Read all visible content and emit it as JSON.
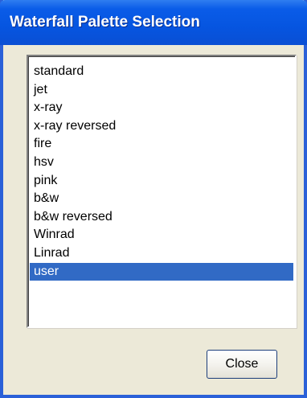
{
  "window": {
    "title": "Waterfall Palette Selection"
  },
  "palette_list": {
    "items": [
      {
        "label": "standard",
        "selected": false
      },
      {
        "label": "jet",
        "selected": false
      },
      {
        "label": "x-ray",
        "selected": false
      },
      {
        "label": "x-ray reversed",
        "selected": false
      },
      {
        "label": "fire",
        "selected": false
      },
      {
        "label": "hsv",
        "selected": false
      },
      {
        "label": "pink",
        "selected": false
      },
      {
        "label": "b&w",
        "selected": false
      },
      {
        "label": "b&w reversed",
        "selected": false
      },
      {
        "label": "Winrad",
        "selected": false
      },
      {
        "label": "Linrad",
        "selected": false
      },
      {
        "label": "user",
        "selected": true
      }
    ]
  },
  "buttons": {
    "close_label": "Close"
  },
  "colors": {
    "title_bar": "#0655e0",
    "selection": "#316ac5",
    "dialog_face": "#ece9d8"
  }
}
